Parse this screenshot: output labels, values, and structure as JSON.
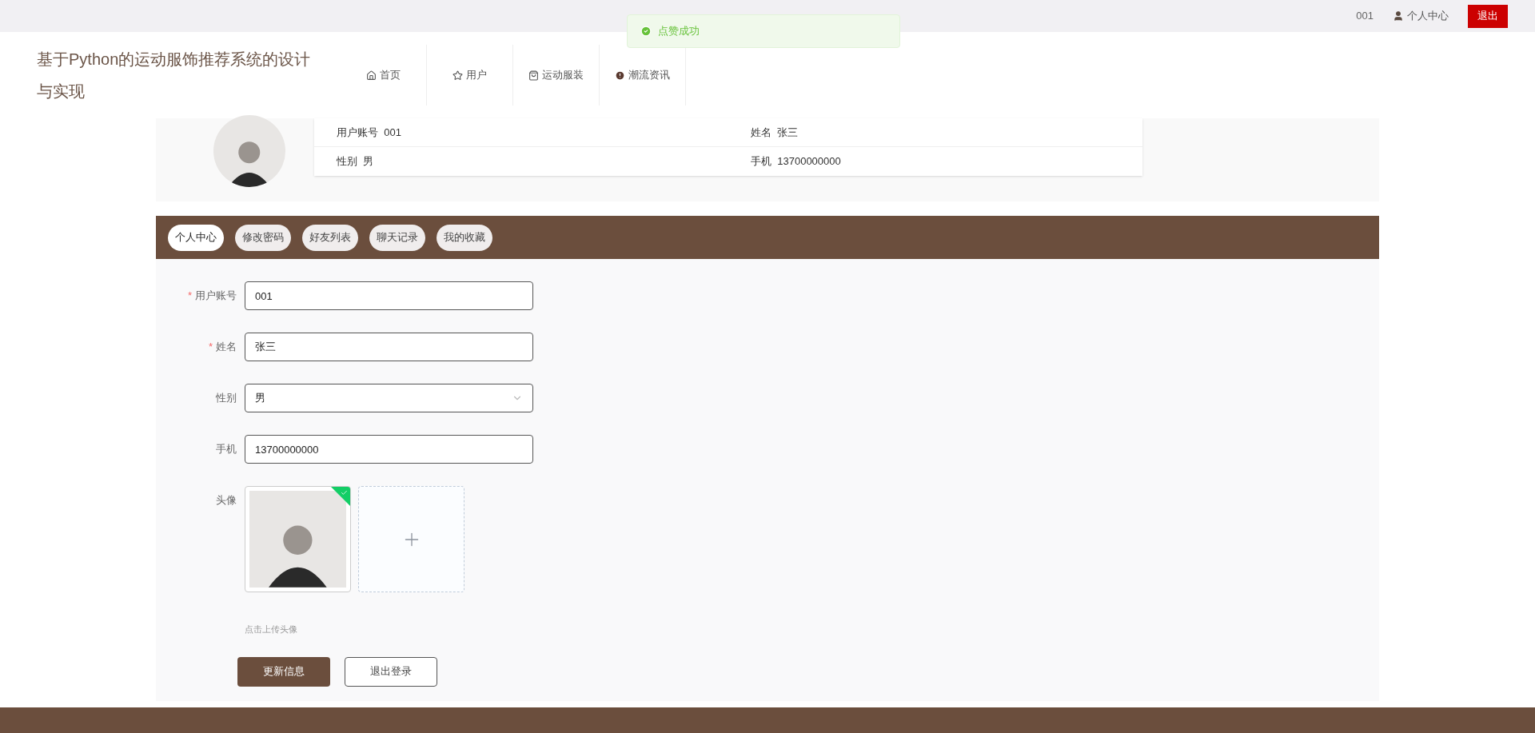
{
  "top_bar": {
    "username": "001",
    "profile_link": "个人中心",
    "logout_button": "退出"
  },
  "toast": {
    "kind": "success",
    "message": "点赞成功"
  },
  "header": {
    "title": "基于Python的运动服饰推荐系统的设计与实现",
    "nav": [
      {
        "label": "首页"
      },
      {
        "label": "用户"
      },
      {
        "label": "运动服装"
      },
      {
        "label": "潮流资讯"
      }
    ]
  },
  "profile_card": {
    "fields": [
      {
        "label": "用户账号",
        "value": "001"
      },
      {
        "label": "姓名",
        "value": "张三"
      },
      {
        "label": "性别",
        "value": "男"
      },
      {
        "label": "手机",
        "value": "13700000000"
      }
    ]
  },
  "tabs": [
    {
      "label": "个人中心",
      "selected": true
    },
    {
      "label": "修改密码",
      "selected": false
    },
    {
      "label": "好友列表",
      "selected": false
    },
    {
      "label": "聊天记录",
      "selected": false
    },
    {
      "label": "我的收藏",
      "selected": false
    }
  ],
  "form": {
    "fields": [
      {
        "kind": "text",
        "required_mark": "*",
        "label": "用户账号",
        "value": "001"
      },
      {
        "kind": "text",
        "required_mark": "*",
        "label": "姓名",
        "value": "张三"
      },
      {
        "kind": "select",
        "label": "性别",
        "value": "男"
      },
      {
        "kind": "text",
        "label": "手机",
        "value": "13700000000"
      },
      {
        "kind": "upload",
        "label": "头像",
        "uploaded": true
      }
    ],
    "upload_hint": "点击上传头像",
    "buttons": [
      {
        "label": "更新信息",
        "kind": "primary"
      },
      {
        "label": "退出登录",
        "kind": "outline"
      }
    ]
  }
}
